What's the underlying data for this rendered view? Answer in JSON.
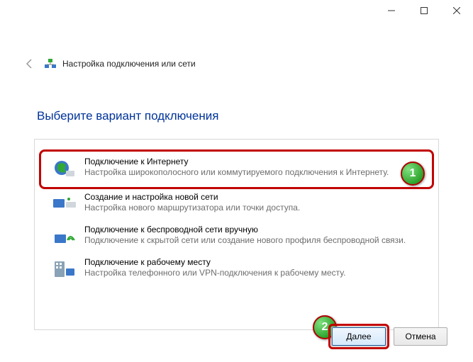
{
  "window": {
    "title": "Настройка подключения или сети"
  },
  "heading": "Выберите вариант подключения",
  "options": [
    {
      "title": "Подключение к Интернету",
      "desc": "Настройка широкополосного или коммутируемого подключения к Интернету."
    },
    {
      "title": "Создание и настройка новой сети",
      "desc": "Настройка нового маршрутизатора или точки доступа."
    },
    {
      "title": "Подключение к беспроводной сети вручную",
      "desc": "Подключение к скрытой сети или создание нового профиля беспроводной связи."
    },
    {
      "title": "Подключение к рабочему месту",
      "desc": "Настройка телефонного или VPN-подключения к рабочему месту."
    }
  ],
  "markers": {
    "one": "1",
    "two": "2"
  },
  "footer": {
    "next": "Далее",
    "cancel": "Отмена"
  }
}
